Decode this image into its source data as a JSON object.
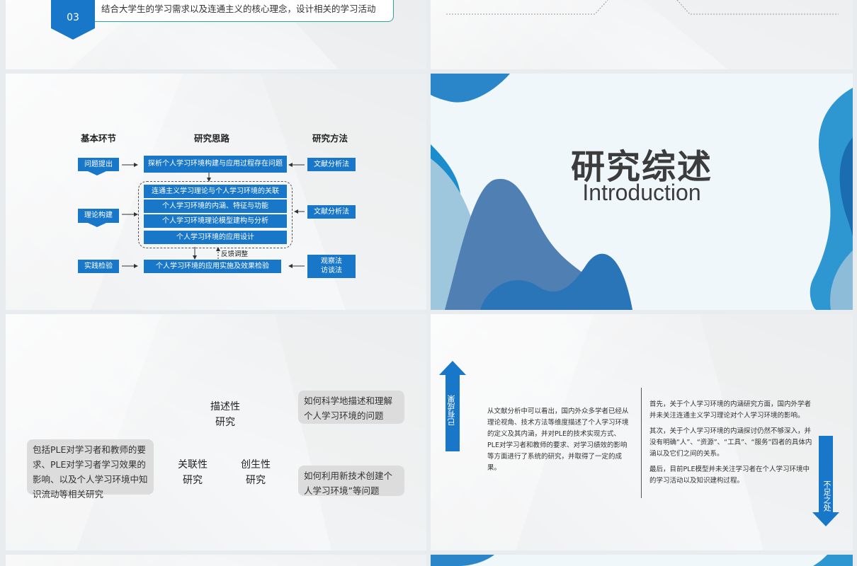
{
  "slide1": {
    "number": "03",
    "text": "结合大学生的学习需求以及连通主义的核心理念，设计相关的学习活动"
  },
  "slide3": {
    "headers": [
      "基本环节",
      "研究思路",
      "研究方法"
    ],
    "stages": [
      "问题提出",
      "理论构建",
      "实践检验"
    ],
    "steps": [
      "探析个人学习环境构建与应用过程存在问题",
      "连通主义学习理论与个人学习环境的关联",
      "个人学习环境的内涵、特征与功能",
      "个人学习环境理论模型建构与分析",
      "个人学习环境的应用设计",
      "个人学习环境的应用实施及效果检验"
    ],
    "methods": [
      "文献分析法",
      "文献分析法",
      "观察法",
      "访谈法"
    ],
    "feedback": "反馈调整"
  },
  "slide4": {
    "title": "研究综述",
    "subtitle": "Introduction"
  },
  "slide5": {
    "left_text": "包括PLE对学习者和教师的要求、PLE对学习者学习效果的影响、以及个人学习环境中知识流动等相关研究",
    "labels": [
      {
        "line1": "描述性",
        "line2": "研究"
      },
      {
        "line1": "关联性",
        "line2": "研究"
      },
      {
        "line1": "创生性",
        "line2": "研究"
      }
    ],
    "right_top": "如何科学地描述和理解个人学习环境的问题",
    "right_bottom": "如何利用新技术创建个人学习环境”等问题"
  },
  "slide6": {
    "arrow_up_label": "已有成果",
    "arrow_down_label": "不足之处",
    "left_para": "从文献分析中可以看出，国内外众多学者已经从理论视角、技术方法等维度描述了个人学习环境的定义及其内涵，并对PLE的技术实现方式、PLE对学习者和教师的要求、对学习绩效的影响等方面进行了系统的研究，并取得了一定的成果。",
    "right_para1": "首先，关于个人学习环境的内涵研究方面，国内外学者并未关注连通主义学习理论对个人学习环境的影响。",
    "right_para2": "其次，关于个人学习环境的内涵探讨仍然不够深入，并没有明确“人”、“资源”、“工具”、“服务”四者的具体内涵以及它们之间的关系。",
    "right_para3": "最后，目前PLE模型并未关注学习者在个人学习环境中的学习活动以及知识建构过程。"
  },
  "colors": {
    "primary_blue": "#1877c9",
    "teal_border": "#2fa59a",
    "title_gray": "#3c3c3c"
  }
}
